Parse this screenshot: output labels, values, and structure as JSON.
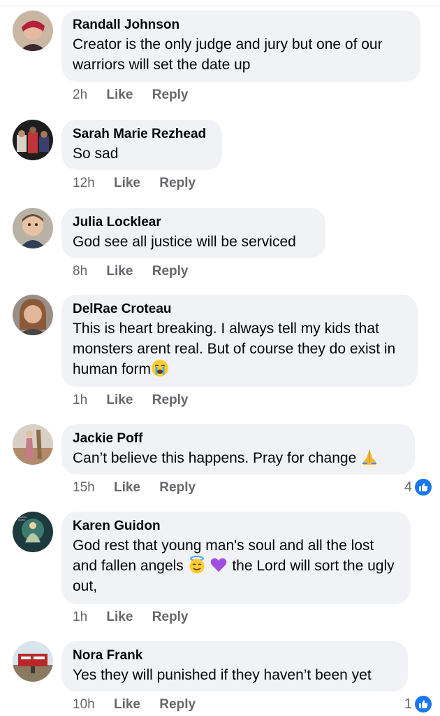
{
  "comments": [
    {
      "author": "Randall Johnson",
      "text": "Creator is the only judge and jury but one of our warriors will set the date up",
      "time": "2h",
      "like": "Like",
      "reply": "Reply"
    },
    {
      "author": "Sarah Marie Rezhead",
      "text": "So sad",
      "time": "12h",
      "like": "Like",
      "reply": "Reply"
    },
    {
      "author": "Julia Locklear",
      "text": "God see all justice will be serviced",
      "time": "8h",
      "like": "Like",
      "reply": "Reply"
    },
    {
      "author": "DelRae Croteau",
      "text": "This is heart breaking. I always tell my kids that monsters arent real. But of course they do exist in human form",
      "emoji": "crying-face-emoji",
      "time": "1h",
      "like": "Like",
      "reply": "Reply"
    },
    {
      "author": "Jackie Poff",
      "text": "Can’t believe this happens. Pray for change",
      "emoji": "praying-hands-emoji",
      "time": "15h",
      "like": "Like",
      "reply": "Reply",
      "reaction_count": "4",
      "reaction_icon": "like-thumb-icon"
    },
    {
      "author": "Karen Guidon",
      "text_before": "God rest that young man's soul and all the lost and fallen angels",
      "emojis": [
        "smiling-face-with-halo-emoji",
        "purple-heart-emoji"
      ],
      "text_after": "the Lord will sort the ugly out,",
      "time": "1h",
      "like": "Like",
      "reply": "Reply"
    },
    {
      "author": "Nora Frank",
      "text": "Yes they will punished if they haven’t been yet",
      "time": "10h",
      "like": "Like",
      "reply": "Reply",
      "reaction_count": "1",
      "reaction_icon": "like-thumb-icon"
    }
  ],
  "colors": {
    "bubble": "#f0f2f5",
    "meta_text": "#65676b",
    "like_blue": "#1877f2"
  }
}
